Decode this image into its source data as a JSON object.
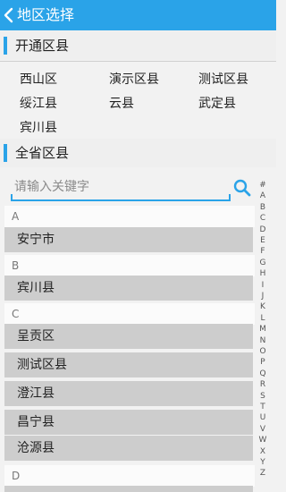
{
  "header": {
    "title": "地区选择",
    "back_icon": "chevron-left-icon"
  },
  "open_section": {
    "title": "开通区县",
    "items": [
      "西山区",
      "演示区县",
      "测试区县",
      "绥江县",
      "云县",
      "武定县",
      "宾川县"
    ]
  },
  "all_section": {
    "title": "全省区县"
  },
  "search": {
    "placeholder": "请输入关键字",
    "icon": "search-icon"
  },
  "groups": [
    {
      "letter": "A",
      "items": [
        "安宁市"
      ]
    },
    {
      "letter": "B",
      "items": [
        "宾川县"
      ]
    },
    {
      "letter": "C",
      "items": [
        "呈贡区",
        "测试区县",
        "澄江县",
        "昌宁县",
        "沧源县"
      ]
    },
    {
      "letter": "D",
      "items": []
    }
  ],
  "index_letters": [
    "#",
    "A",
    "B",
    "C",
    "D",
    "E",
    "F",
    "G",
    "H",
    "I",
    "J",
    "K",
    "L",
    "M",
    "N",
    "O",
    "P",
    "Q",
    "R",
    "S",
    "T",
    "U",
    "V",
    "W",
    "X",
    "Y",
    "Z"
  ],
  "colors": {
    "accent": "#2aa3e8",
    "row_bg": "#cdcdcd",
    "page_bg": "#f2f2f2"
  }
}
